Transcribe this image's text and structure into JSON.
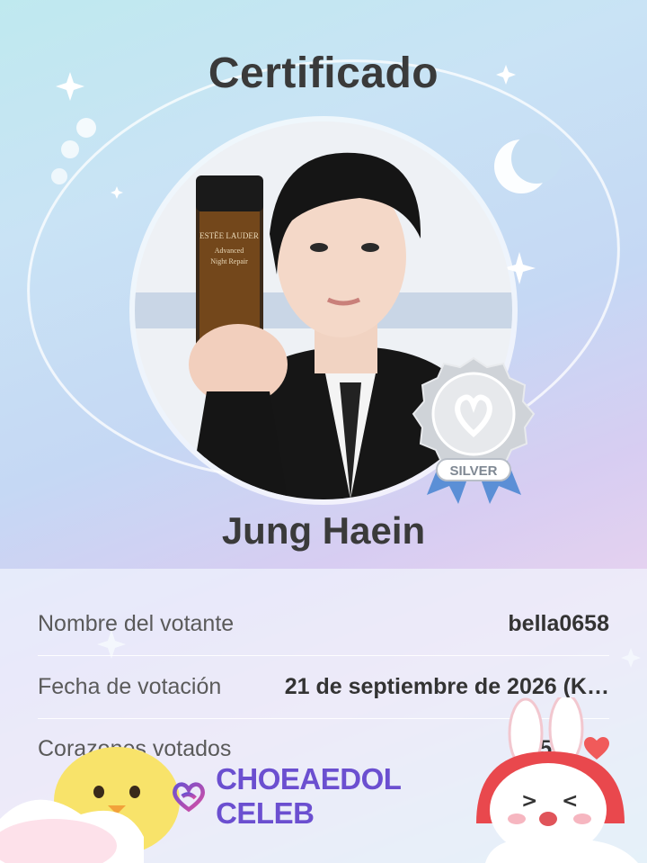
{
  "certificate": {
    "title": "Certificado",
    "celebrity_name": "Jung Haein",
    "badge_level": "SILVER"
  },
  "details": {
    "voter_label": "Nombre del votante",
    "voter_value": "bella0658",
    "date_label": "Fecha de votación",
    "date_value": "21 de septiembre de 2026 (K…",
    "hearts_label": "Corazones votados",
    "hearts_value": "1.500"
  },
  "product_text": {
    "brand": "ESTĒE LAUDER",
    "line1": "Advanced",
    "line2": "Night Repair"
  },
  "brand": {
    "name": "CHOEAEDOL CELEB"
  },
  "colors": {
    "brand": "#6b4fd0",
    "heart": "#f05a5a",
    "badge_ribbon": "#5b8fd6"
  }
}
